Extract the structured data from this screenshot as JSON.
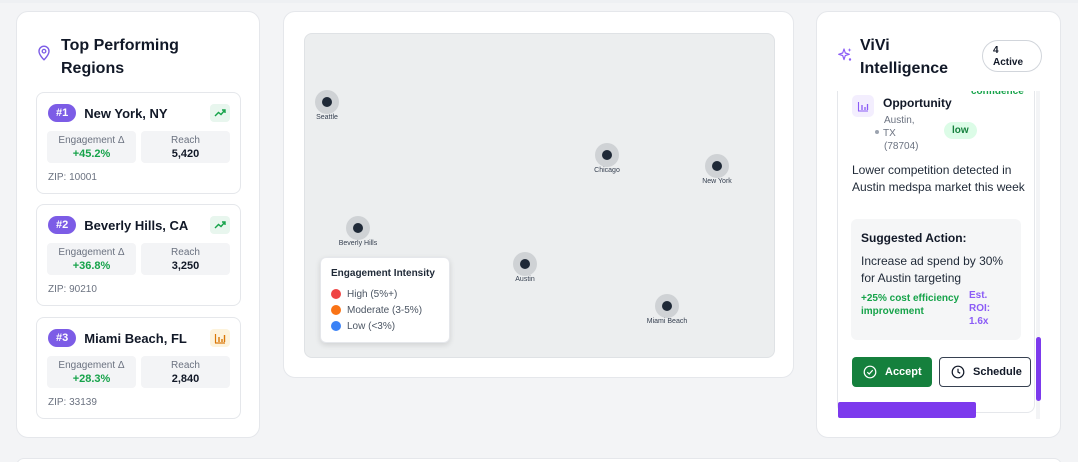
{
  "regions": {
    "title": "Top Performing Regions",
    "items": [
      {
        "rank": "#1",
        "name": "New York, NY",
        "engagement_label": "Engagement Δ",
        "engagement": "+45.2%",
        "reach_label": "Reach",
        "reach": "5,420",
        "zip": "ZIP: 10001",
        "trend_icon": "trending-up-icon"
      },
      {
        "rank": "#2",
        "name": "Beverly Hills, CA",
        "engagement_label": "Engagement Δ",
        "engagement": "+36.8%",
        "reach_label": "Reach",
        "reach": "3,250",
        "zip": "ZIP: 90210",
        "trend_icon": "trending-up-icon"
      },
      {
        "rank": "#3",
        "name": "Miami Beach, FL",
        "engagement_label": "Engagement Δ",
        "engagement": "+28.3%",
        "reach_label": "Reach",
        "reach": "2,840",
        "zip": "ZIP: 33139",
        "trend_icon": "bar-chart-icon"
      }
    ]
  },
  "map": {
    "cities": [
      "Seattle",
      "Chicago",
      "New York",
      "Beverly Hills",
      "Austin",
      "Miami Beach"
    ],
    "legend": {
      "title": "Engagement Intensity",
      "items": [
        {
          "label": "High (5%+)",
          "color": "#ef4444"
        },
        {
          "label": "Moderate (3-5%)",
          "color": "#f97316"
        },
        {
          "label": "Low (<3%)",
          "color": "#3b82f6"
        }
      ]
    }
  },
  "vivi": {
    "title": "ViVi Intelligence",
    "active_count": "4",
    "active_label": "Active",
    "insight": {
      "confidence": "confidence",
      "type": "Opportunity",
      "location_city": "Austin,",
      "location_state": "TX",
      "location_zip": "(78704)",
      "priority": "low",
      "description": "Lower competition detected in Austin medspa market this week",
      "suggested_title": "Suggested Action:",
      "suggested_text": "Increase ad spend by 30% for Austin targeting",
      "impact": "+25% cost efficiency improvement",
      "roi": "Est. ROI: 1.6x",
      "accept_label": "Accept",
      "schedule_label": "Schedule"
    }
  },
  "colors": {
    "accent": "#7c3aed",
    "success": "#16a34a",
    "accept_bg": "#15803d"
  }
}
